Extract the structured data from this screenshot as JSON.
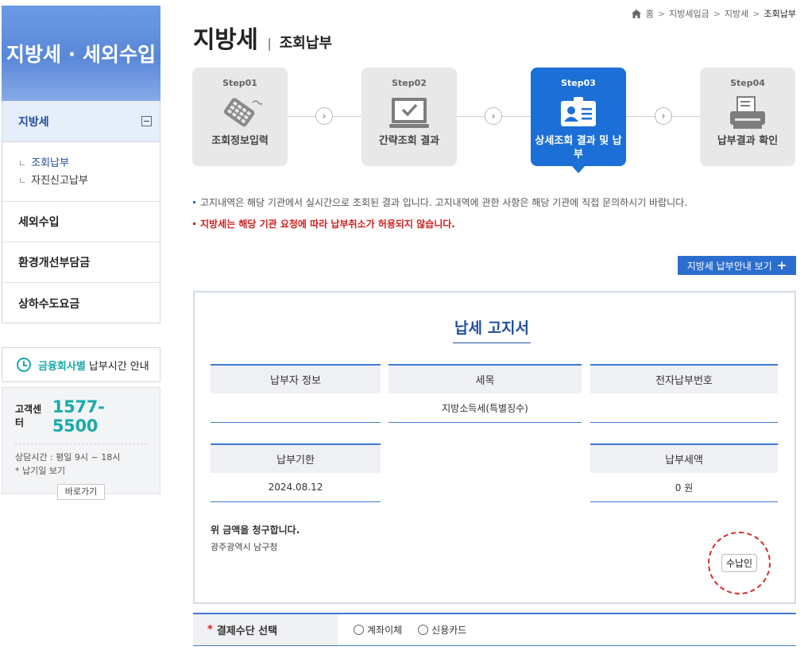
{
  "sidebar": {
    "header": "지방세 · 세외수입",
    "active_menu": "지방세",
    "sub_items": [
      {
        "label": "조회납부",
        "selected": true
      },
      {
        "label": "자진신고납부",
        "selected": false
      }
    ],
    "menu_items": [
      "세외수입",
      "환경개선부담금",
      "상하수도요금"
    ],
    "payment_time": {
      "highlight": "금융회사별",
      "text": "납부시간 안내"
    },
    "customer_center": {
      "label": "고객센터",
      "phone": "1577-5500",
      "hours": "상담시간 : 평일 9시 ~ 18시",
      "due_date_link": "* 납기일 보기",
      "go_button": "바로가기"
    }
  },
  "breadcrumb": [
    "홈",
    "지방세입금",
    "지방세",
    "조회납부"
  ],
  "page": {
    "title": "지방세",
    "subtitle": "조회납부"
  },
  "steps": [
    {
      "no": "Step01",
      "label": "조회정보입력",
      "icon": "keypad-icon",
      "active": false
    },
    {
      "no": "Step02",
      "label": "간략조회 결과",
      "icon": "monitor-check-icon",
      "active": false
    },
    {
      "no": "Step03",
      "label": "상세조회 결과 및 납부",
      "icon": "id-card-icon",
      "active": true
    },
    {
      "no": "Step04",
      "label": "납부결과 확인",
      "icon": "printer-icon",
      "active": false
    }
  ],
  "notices": [
    "고지내역은 해당 기관에서 실시간으로 조회된 결과 입니다. 고지내역에 관한 사항은 해당 기관에 직접 문의하시기 바랍니다.",
    "지방세는 해당 기관 요청에 따라 납부취소가 허용되지 않습니다."
  ],
  "guide_button": "지방세 납부안내 보기",
  "bill": {
    "title": "납세 고지서",
    "payer_info": {
      "label": "납부자 정보",
      "value": ""
    },
    "tax_item": {
      "label": "세목",
      "value": "지방소득세(특별징수)"
    },
    "e_pay_no": {
      "label": "전자납부번호",
      "value": ""
    },
    "due_date": {
      "label": "납부기한",
      "value": "2024.08.12"
    },
    "amount": {
      "label": "납부세액",
      "value": "0 원"
    },
    "claim_text": "위 금액을 청구합니다.",
    "organization": "광주광역시 남구청",
    "stamp": "수납인"
  },
  "payment": {
    "label": "결제수단 선택",
    "required_mark": "*",
    "options": [
      "계좌이체",
      "신용카드"
    ]
  },
  "colors": {
    "brand_blue": "#1b6fd6",
    "accent_teal": "#1aaaaa",
    "warning_red": "#d21f1f"
  }
}
